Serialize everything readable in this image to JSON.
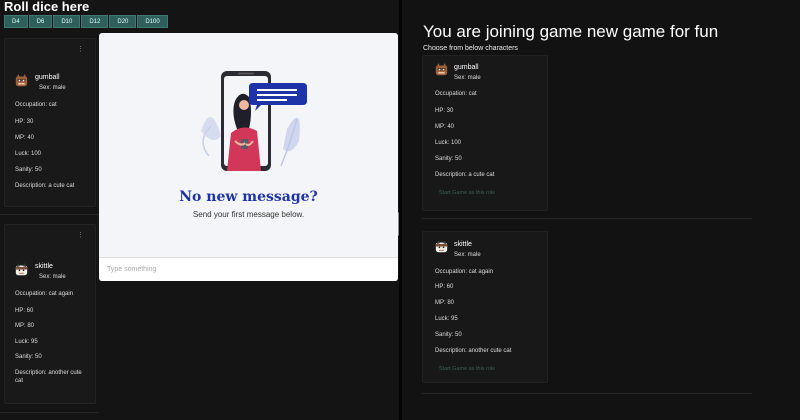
{
  "left": {
    "title": "Roll dice here",
    "dice": [
      "D4",
      "D6",
      "D10",
      "D12",
      "D20",
      "D100"
    ]
  },
  "characters": [
    {
      "name": "gumball",
      "sex": "Sex: male",
      "occupation": "Occupation: cat",
      "hp": "HP: 30",
      "mp": "MP: 40",
      "luck": "Luck: 100",
      "sanity": "Sanity: 50",
      "description": "Description: a cute cat"
    },
    {
      "name": "skittle",
      "sex": "Sex: male",
      "occupation": "Occupation: cat again",
      "hp": "HP: 60",
      "mp": "MP: 80",
      "luck": "Luck: 95",
      "sanity": "Sanity: 50",
      "description": "Description: another cute cat"
    }
  ],
  "chat": {
    "empty_title": "No new message?",
    "empty_subtitle": "Send your first message below.",
    "input_placeholder": "Type something"
  },
  "right": {
    "title": "You are joining game new game for fun",
    "subtitle": "Choose from below characters",
    "start_button": "Start Game as this role"
  },
  "colors": {
    "dice_button": "#2e5f5b",
    "headline_blue": "#1f33a8",
    "background": "#121212"
  },
  "icons": {
    "more": "more-vertical-icon",
    "avatar": "cat-avatar-icon",
    "illustration": "phone-message-illustration"
  }
}
